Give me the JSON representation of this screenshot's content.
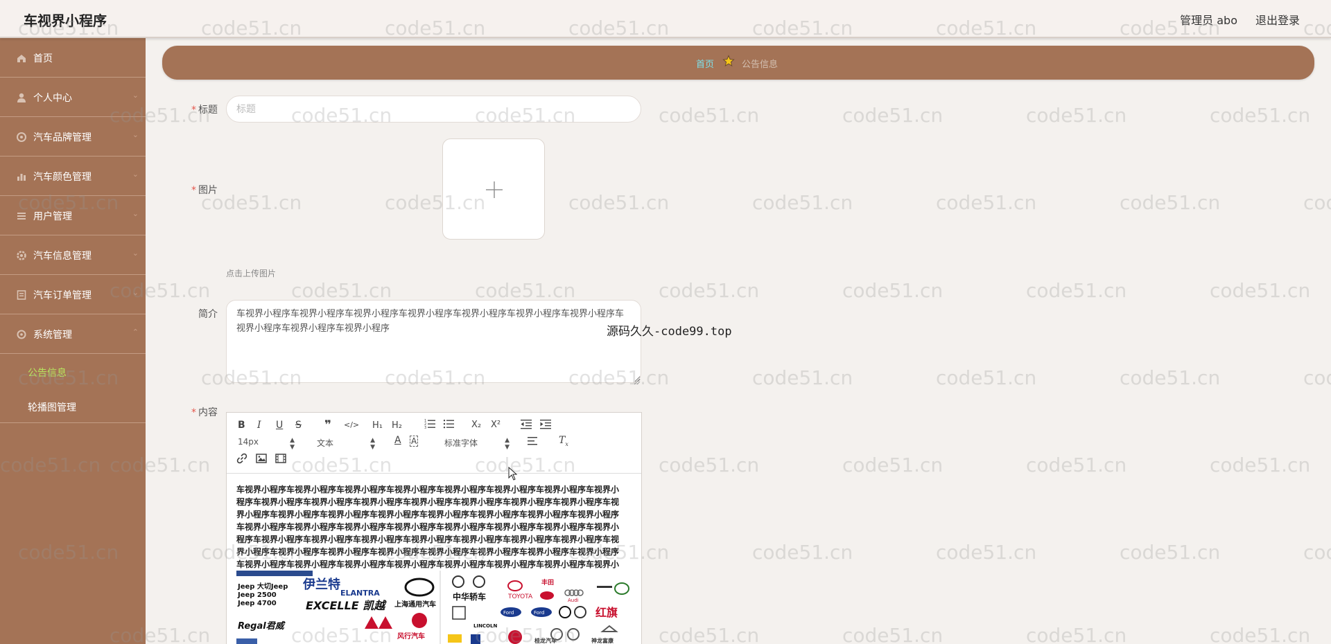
{
  "app": {
    "title": "车视界小程序"
  },
  "header": {
    "admin": "管理员 abo",
    "logout": "退出登录"
  },
  "sidebar": {
    "items": [
      {
        "label": "首页",
        "icon": "home-icon"
      },
      {
        "label": "个人中心",
        "icon": "user-icon"
      },
      {
        "label": "汽车品牌管理",
        "icon": "brand-icon"
      },
      {
        "label": "汽车颜色管理",
        "icon": "bar-chart-icon"
      },
      {
        "label": "用户管理",
        "icon": "list-icon"
      },
      {
        "label": "汽车信息管理",
        "icon": "gear-icon"
      },
      {
        "label": "汽车订单管理",
        "icon": "order-icon"
      },
      {
        "label": "系统管理",
        "icon": "settings-icon"
      }
    ],
    "sub_items": [
      {
        "label": "公告信息",
        "active": true
      },
      {
        "label": "轮播图管理",
        "active": false
      }
    ]
  },
  "breadcrumb": {
    "home": "首页",
    "current": "公告信息"
  },
  "form": {
    "title_label": "标题",
    "title_placeholder": "标题",
    "image_label": "图片",
    "upload_hint": "点击上传图片",
    "summary_label": "简介",
    "summary_value": "车视界小程序车视界小程序车视界小程序车视界小程序车视界小程序车视界小程序车视界小程序车视界小程序车视界小程序车视界小程序",
    "content_label": "内容",
    "note": "源码久久-code99.top"
  },
  "editor": {
    "font_size": "14px",
    "format": "文本",
    "font_family": "标准字体",
    "content": "车视界小程序车视界小程序车视界小程序车视界小程序车视界小程序车视界小程序车视界小程序车视界小程序车视界小程序车视界小程序车视界小程序车视界小程序车视界小程序车视界小程序车视界小程序车视界小程序车视界小程序车视界小程序车视界小程序车视界小程序车视界小程序车视界小程序车视界小程序车视界小程序车视界小程序车视界小程序车视界小程序车视界小程序车视界小程序车视界小程序车视界小程序车视界小程序车视界小程序车视界小程序车视界小程序车视界小程序车视界小程序车视界小程序车视界小程序车视界小程序车视界小程序车视界小程序车视界小程序车视界小程序车视界小程序车视界小程序车视界小程序车视界小程序车视界小程序车视界小程序车视界小程序车视界小程序车视界小程序车视界小程序车视界小程序",
    "logo_texts": [
      "Jeep 大切Jeep",
      "Jeep 2500",
      "Jeep 4700",
      "伊兰特",
      "ELANTRA",
      "EXCELLE 凯越",
      "上海通用汽车",
      "Regal君威",
      "中华轿车",
      "TOYOTA",
      "Audi",
      "Ford",
      "LINCOLN",
      "红旗"
    ]
  },
  "watermark": "code51.cn",
  "colors": {
    "accent": "#a47356",
    "active_sub": "#b7e55f",
    "breadcrumb_home": "#7ee0ea"
  }
}
